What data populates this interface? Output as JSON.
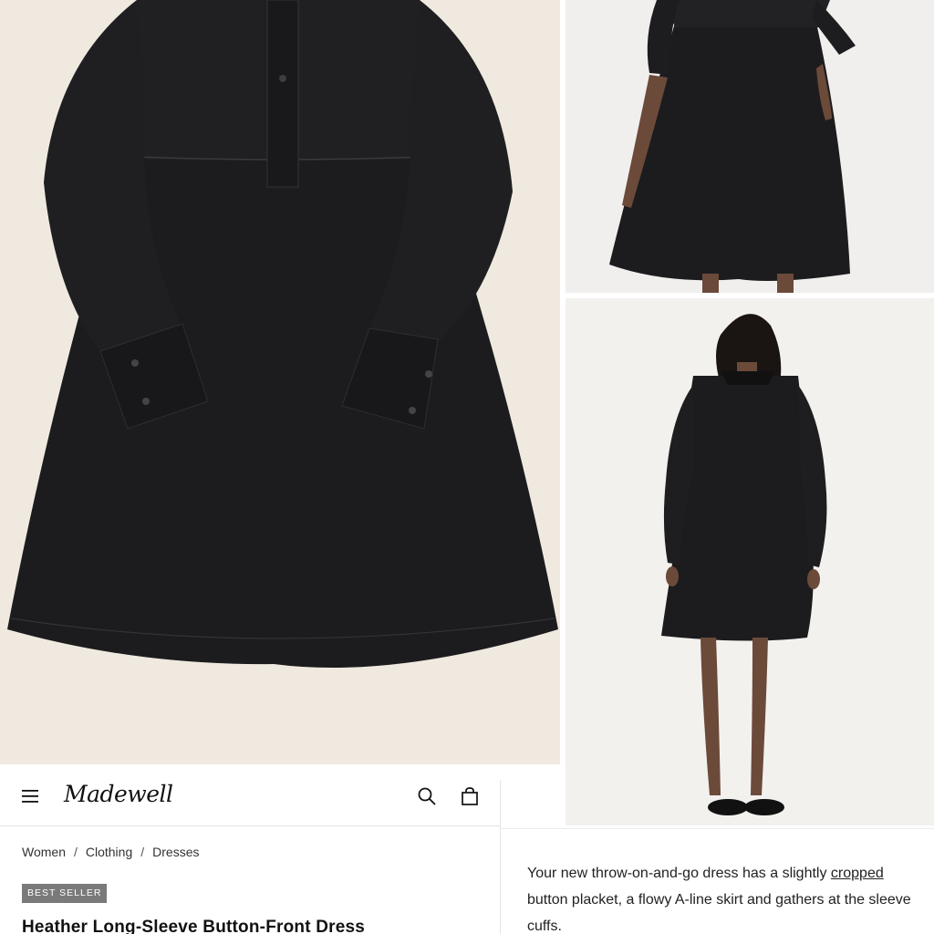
{
  "header": {
    "brand": "Madewell",
    "menu_icon": "hamburger-menu-icon",
    "search_icon": "search-icon",
    "bag_icon": "shopping-bag-icon"
  },
  "breadcrumb": {
    "items": [
      "Women",
      "Clothing",
      "Dresses"
    ],
    "separator": "/"
  },
  "product": {
    "badge": "BEST SELLER",
    "title": "Heather Long-Sleeve Button-Front Dress",
    "description_before": "Your new throw-on-and-go dress has a slightly ",
    "description_link": "cropped",
    "description_after": " button placket, a flowy A-line skirt and gathers at the sleeve cuffs."
  },
  "gallery": {
    "main_image": "flat-lay-black-dress-photo",
    "side_top_image": "model-front-dress-photo",
    "side_bottom_image": "model-back-dress-photo"
  },
  "colors": {
    "dress": "#1c1c1e",
    "badge_bg": "#7a7a7a",
    "main_bg": "#efe9df",
    "side_bg": "#f1efed"
  }
}
